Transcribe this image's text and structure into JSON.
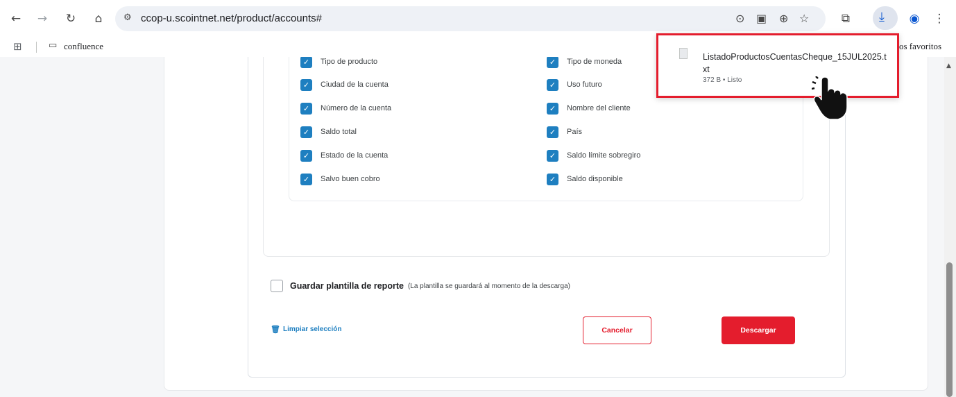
{
  "browser": {
    "url": "ccop-u.scointnet.net/product/accounts#",
    "bookmark_folder": "confluence",
    "bookmarks_right": "os favoritos"
  },
  "form": {
    "fields": [
      {
        "label": "Tipo de producto",
        "checked": true
      },
      {
        "label": "Tipo de moneda",
        "checked": true
      },
      {
        "label": "Ciudad de la cuenta",
        "checked": true
      },
      {
        "label": "Uso futuro",
        "checked": true
      },
      {
        "label": "Número de la cuenta",
        "checked": true
      },
      {
        "label": "Nombre del cliente",
        "checked": true
      },
      {
        "label": "Saldo total",
        "checked": true
      },
      {
        "label": "País",
        "checked": true
      },
      {
        "label": "Estado de la cuenta",
        "checked": true
      },
      {
        "label": "Saldo límite sobregiro",
        "checked": true
      },
      {
        "label": "Salvo buen cobro",
        "checked": true
      },
      {
        "label": "Saldo disponible",
        "checked": true
      }
    ],
    "save_template_label": "Guardar plantilla de reporte",
    "save_template_note": "(La plantilla se guardará al momento de la descarga)",
    "save_template_checked": false,
    "clear_selection": "Limpiar selección",
    "cancel_label": "Cancelar",
    "download_label": "Descargar"
  },
  "download_bubble": {
    "file_name": "ListadoProductosCuentasCheque_15JUL2025.txt",
    "meta": "372 B • Listo"
  },
  "colors": {
    "accent_red": "#e41d2d",
    "checkbox_blue": "#1e7fc0"
  }
}
